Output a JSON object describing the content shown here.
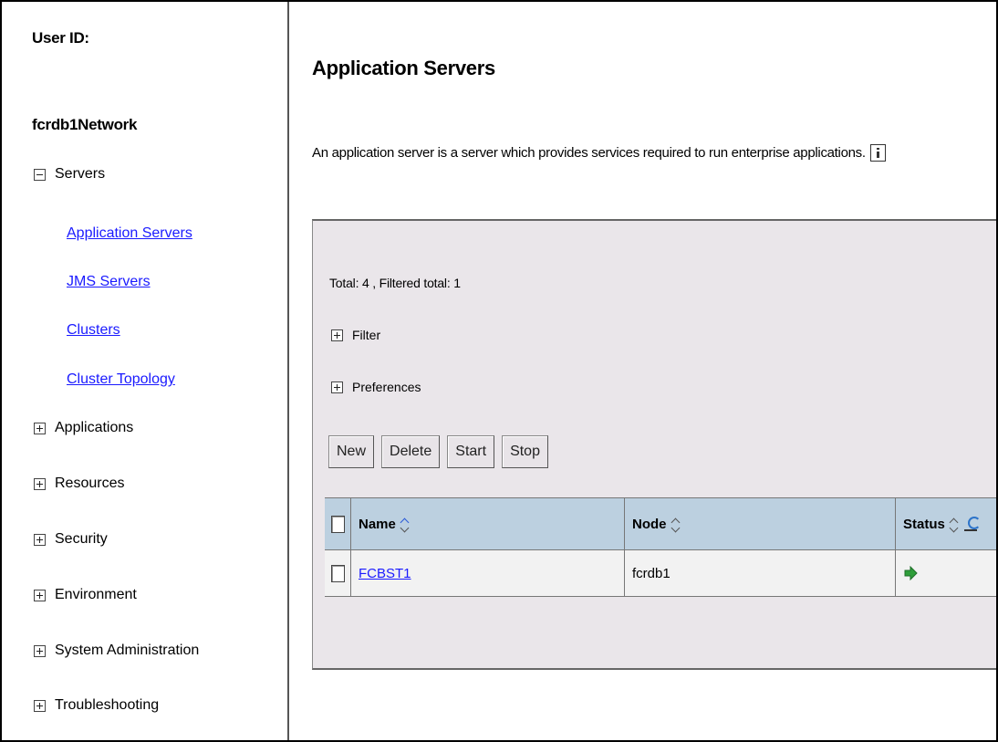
{
  "nav": {
    "user_id_label": "User ID:",
    "cell_name": "fcrdb1Network",
    "servers": {
      "label": "Servers",
      "expanded": true,
      "links": [
        "Application Servers",
        "JMS Servers",
        "Clusters",
        "Cluster Topology"
      ]
    },
    "sections": [
      "Applications",
      "Resources",
      "Security",
      "Environment",
      "System Administration",
      "Troubleshooting"
    ]
  },
  "main": {
    "title": "Application Servers",
    "description": "An application server is a server which provides services required to run enterprise applications.",
    "totals": "Total: 4 , Filtered total: 1",
    "filter_label": "Filter",
    "preferences_label": "Preferences",
    "buttons": {
      "new": "New",
      "delete": "Delete",
      "start": "Start",
      "stop": "Stop"
    },
    "table": {
      "columns": {
        "name": "Name",
        "node": "Node",
        "status": "Status"
      },
      "rows": [
        {
          "name": "FCBST1",
          "node": "fcrdb1",
          "status": "started"
        }
      ]
    }
  },
  "colors": {
    "link": "#1a1aff",
    "table_header": "#bcd0e0",
    "panel": "#eae6ea",
    "status_started": "#2e9e3a"
  },
  "icons": {
    "info": "info-icon",
    "refresh": "refresh-icon",
    "status": "started-arrow-icon"
  }
}
